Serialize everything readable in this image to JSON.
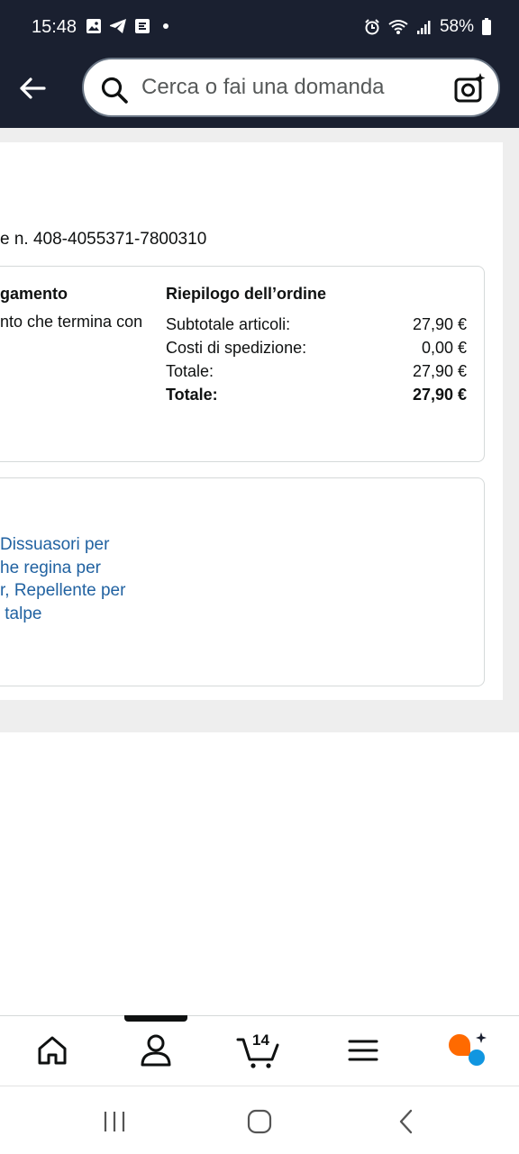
{
  "status_bar": {
    "time": "15:48",
    "battery": "58%"
  },
  "header": {
    "search_placeholder": "Cerca o fai una domanda"
  },
  "order": {
    "number_text": "e n. 408-4055371-7800310",
    "payment_title": "gamento",
    "payment_text": "nto che termina con",
    "summary_title": "Riepilogo dell’ordine",
    "summary_rows": [
      {
        "label": "Subtotale articoli:",
        "value": "27,90 €"
      },
      {
        "label": "Costi di spedizione:",
        "value": "0,00 €"
      },
      {
        "label": "Totale:",
        "value": "27,90 €"
      },
      {
        "label": "Totale:",
        "value": "27,90 €"
      }
    ],
    "product_link": "Dissuasori per\nhe regina per\nr, Repellente per\n talpe"
  },
  "bottom_nav": {
    "cart_count": "14",
    "items": [
      "home-icon",
      "account-icon",
      "cart-icon",
      "menu-icon",
      "rufus-icon"
    ]
  },
  "colors": {
    "header_bg": "#1a2030",
    "link": "#2162a1",
    "rufus_orange": "#ff6a00",
    "rufus_blue": "#1196e0"
  }
}
